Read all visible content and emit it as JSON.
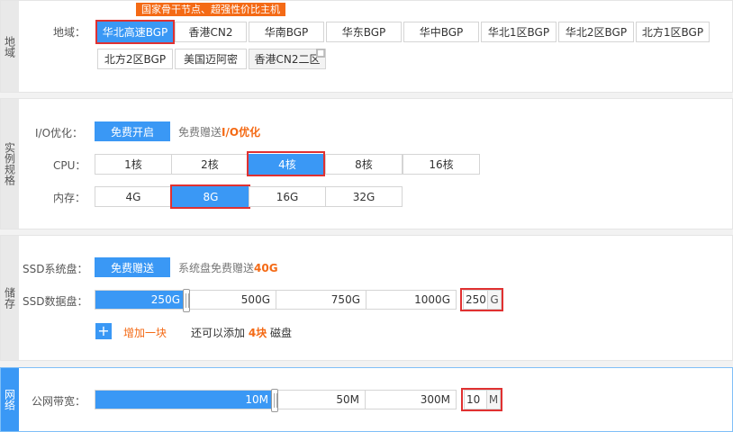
{
  "region": {
    "side_label": "地域",
    "label": "地域：",
    "promo_badge": "国家骨干节点、超强性价比主机",
    "options": [
      "华北高速BGP",
      "香港CN2",
      "华南BGP",
      "华东BGP",
      "华中BGP",
      "华北1区BGP",
      "华北2区BGP",
      "北方1区BGP",
      "北方2区BGP",
      "美国迈阿密",
      "香港CN2二区"
    ],
    "selected": "华北高速BGP"
  },
  "instance": {
    "side_label": "实例规格",
    "io_label": "I/O优化：",
    "io_button": "免费开启",
    "io_note_prefix": "免费赠送",
    "io_note_highlight": "I/O优化",
    "cpu_label": "CPU：",
    "cpu_options": [
      "1核",
      "2核",
      "4核",
      "8核",
      "16核"
    ],
    "cpu_selected": "4核",
    "mem_label": "内存：",
    "mem_options": [
      "4G",
      "8G",
      "16G",
      "32G"
    ],
    "mem_selected": "8G"
  },
  "storage": {
    "side_label": "储存",
    "ssd_sys_label": "SSD系统盘：",
    "ssd_sys_button": "免费赠送",
    "ssd_sys_note_prefix": "系统盘免费赠送",
    "ssd_sys_note_highlight": "40G",
    "ssd_data_label": "SSD数据盘：",
    "ssd_data_ticks": [
      "250G",
      "500G",
      "750G",
      "1000G"
    ],
    "ssd_data_value": "250",
    "ssd_data_unit": "G",
    "ssd_data_fill_fraction": 0.25,
    "add_text": "增加一块",
    "add_plus": "+",
    "add_note_prefix": "还可以添加",
    "add_note_count": "4块",
    "add_note_suffix": "磁盘"
  },
  "network": {
    "side_label": "网络",
    "bandwidth_label": "公网带宽：",
    "bandwidth_ticks": [
      "10M",
      "50M",
      "300M"
    ],
    "bandwidth_value": "10",
    "bandwidth_unit": "M"
  },
  "colors": {
    "accent": "#3a98f5",
    "highlight": "#f46a15",
    "mark": "#e03131"
  }
}
